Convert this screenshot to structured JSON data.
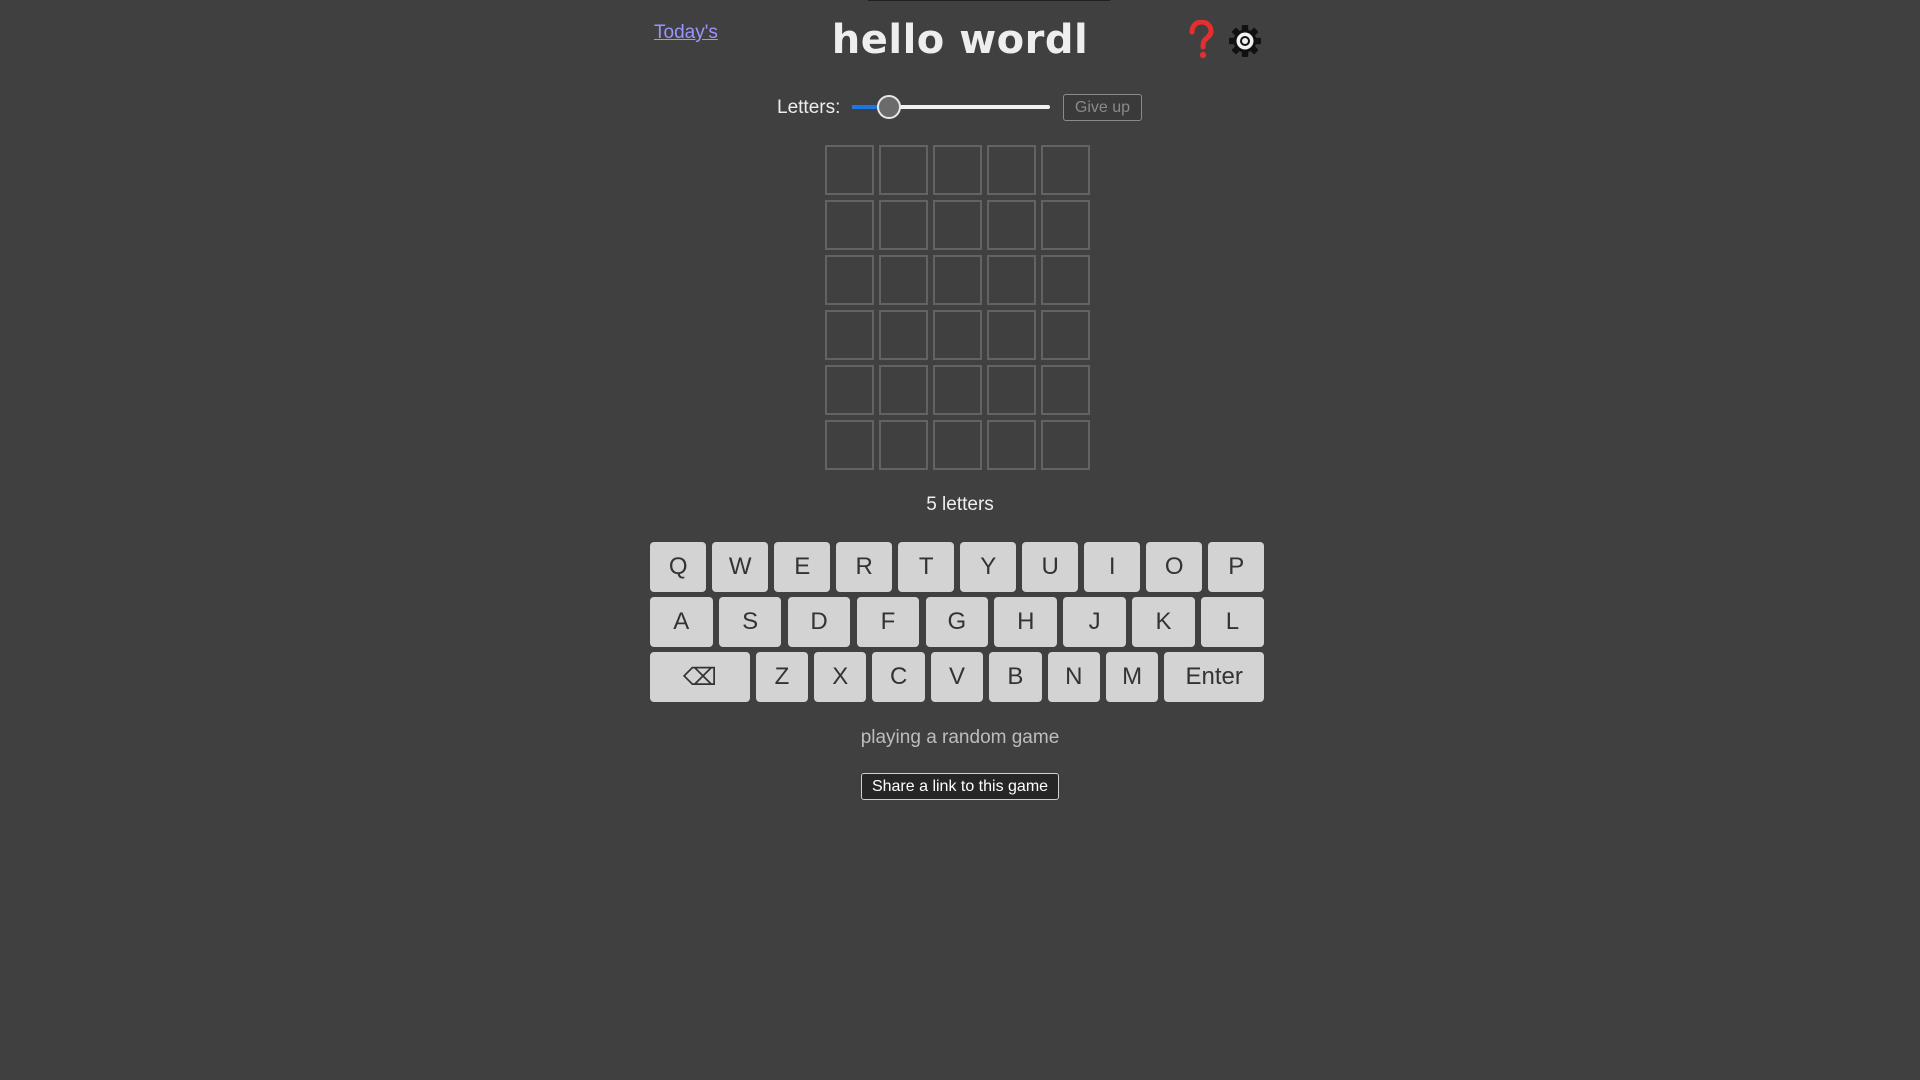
{
  "header": {
    "todays_link": "Today's",
    "title": "hello wordl",
    "help_icon": "question-mark-icon",
    "settings_icon": "gear-icon"
  },
  "controls": {
    "letters_label": "Letters:",
    "slider_value": 5,
    "slider_min": 4,
    "slider_max": 11,
    "give_up_label": "Give up"
  },
  "board": {
    "rows": 6,
    "columns": 5,
    "guesses": []
  },
  "length_text": "5 letters",
  "keyboard": {
    "row1": [
      "Q",
      "W",
      "E",
      "R",
      "T",
      "Y",
      "U",
      "I",
      "O",
      "P"
    ],
    "row2": [
      "A",
      "S",
      "D",
      "F",
      "G",
      "H",
      "J",
      "K",
      "L"
    ],
    "row3": [
      "⌫",
      "Z",
      "X",
      "C",
      "V",
      "B",
      "N",
      "M",
      "Enter"
    ]
  },
  "status_text": "playing a random game",
  "share_button_label": "Share a link to this game",
  "colors": {
    "background": "#404040",
    "link": "#9c94ff",
    "help_icon": "#e52f2f",
    "slider_fill": "#1976e3",
    "key_background": "#d3d3d3",
    "tile_border": "#636363"
  }
}
